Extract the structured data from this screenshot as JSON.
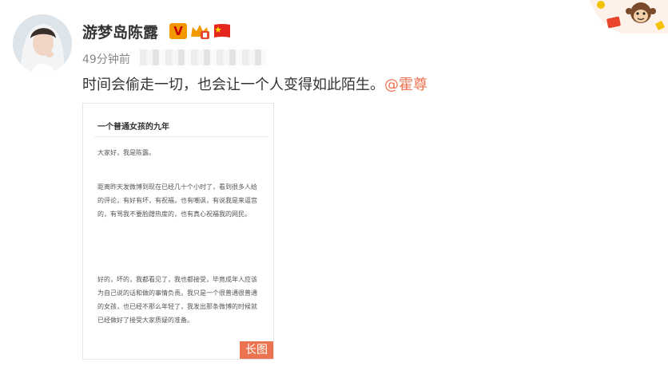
{
  "user": {
    "name": "游梦岛陈露",
    "avatar_icon": "avatar-photo",
    "badges": [
      "verified-v-icon",
      "member-level-icon",
      "china-flag-icon"
    ],
    "verified_label": "V"
  },
  "post": {
    "time": "49分钟前",
    "text": "时间会偷走一切，也会让一个人变得如此陌生。",
    "mention": "@霍尊"
  },
  "long_image": {
    "title": "一个普通女孩的九年",
    "paragraphs": [
      "大家好，我是陈露。",
      "距离昨天发微博到现在已经几十个小时了，看到很多人给的评论，有好有坏，有祝福，也有嘲讽，有说我是来逼宫的，有骂我不要脸蹭热度的，也有真心祝福我的网民。",
      "好的，坏的，我都看见了，我也都接受，毕竟成年人应该为自己说的话和做的事情负责。我只是一个很普通很普通的女孩，也已经不那么年轻了，我发出那条微博的时候就已经做好了接受大家质疑的准备。"
    ],
    "tag": "长图"
  },
  "colors": {
    "accent": "#eb7350",
    "meta": "#888888",
    "text": "#333333"
  }
}
